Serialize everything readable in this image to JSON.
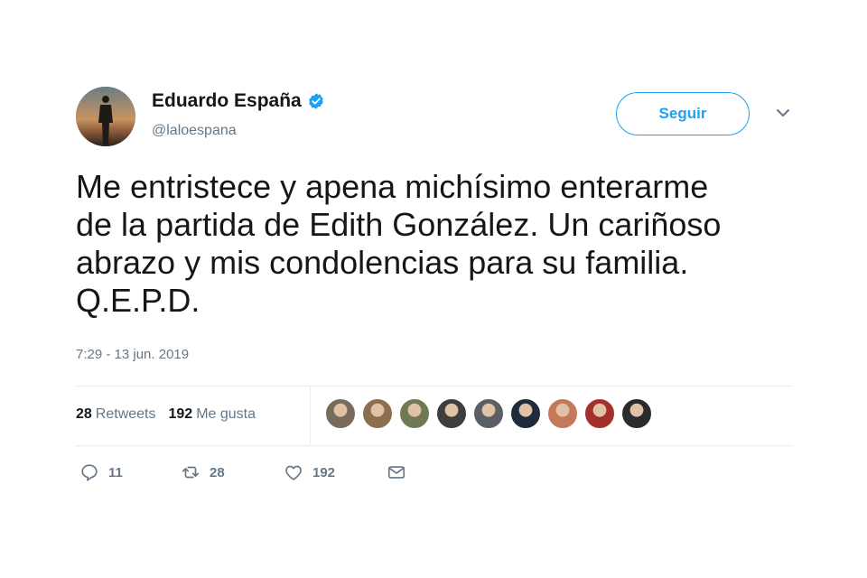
{
  "author": {
    "display_name": "Eduardo España",
    "handle": "@laloespana",
    "verified": true
  },
  "follow_button": {
    "label": "Seguir"
  },
  "tweet": {
    "text_lines": [
      "Me entristece y apena michísimo enterarme",
      "de la partida de Edith González. Un cariñoso",
      "abrazo y mis condolencias para su familia.",
      "Q.E.P.D."
    ],
    "timestamp": "7:29 - 13 jun. 2019"
  },
  "stats": {
    "retweets_count": "28",
    "retweets_label": "Retweets",
    "likes_count": "192",
    "likes_label": "Me gusta"
  },
  "likers": [
    {
      "color": "#7a6a5c"
    },
    {
      "color": "#8c6f4e"
    },
    {
      "color": "#6f7a55"
    },
    {
      "color": "#3e3e3e"
    },
    {
      "color": "#5a5f66"
    },
    {
      "color": "#1f2a3a"
    },
    {
      "color": "#c47a5a"
    },
    {
      "color": "#a4302c"
    },
    {
      "color": "#2b2b2b"
    }
  ],
  "actions": {
    "reply_count": "11",
    "retweet_count": "28",
    "like_count": "192"
  },
  "colors": {
    "accent": "#1da1f2",
    "secondary_text": "#657786",
    "primary_text": "#14171a",
    "divider": "#e6ecf0"
  }
}
